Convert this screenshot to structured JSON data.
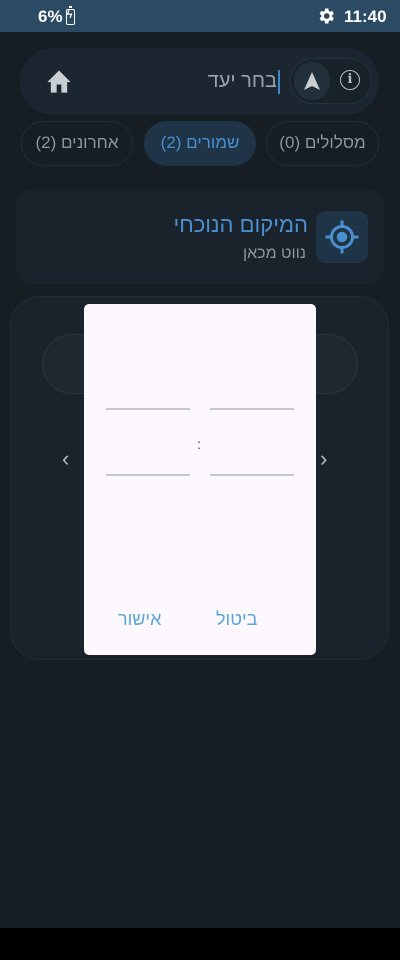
{
  "status_bar": {
    "battery": "6%",
    "time": "11:40"
  },
  "search": {
    "placeholder": "בחר יעד"
  },
  "tabs": [
    {
      "label": "מסלולים (0)",
      "active": false
    },
    {
      "label": "שמורים (2)",
      "active": true
    },
    {
      "label": "אחרונים (2)",
      "active": false
    }
  ],
  "current_location": {
    "title": "המיקום הנוכחי",
    "subtitle": "נווט מכאן"
  },
  "dialog": {
    "separator": ":",
    "confirm": "אישור",
    "cancel": "ביטול"
  },
  "colors": {
    "accent": "#4a8fd0",
    "dialog_button": "#5aa6d8",
    "status_bar": "#2b4a63"
  },
  "icons": [
    "home-icon",
    "navigation-arrow-icon",
    "info-icon",
    "gear-icon",
    "battery-charging-icon",
    "my-location-icon",
    "chevron-left-icon",
    "chevron-right-icon"
  ]
}
